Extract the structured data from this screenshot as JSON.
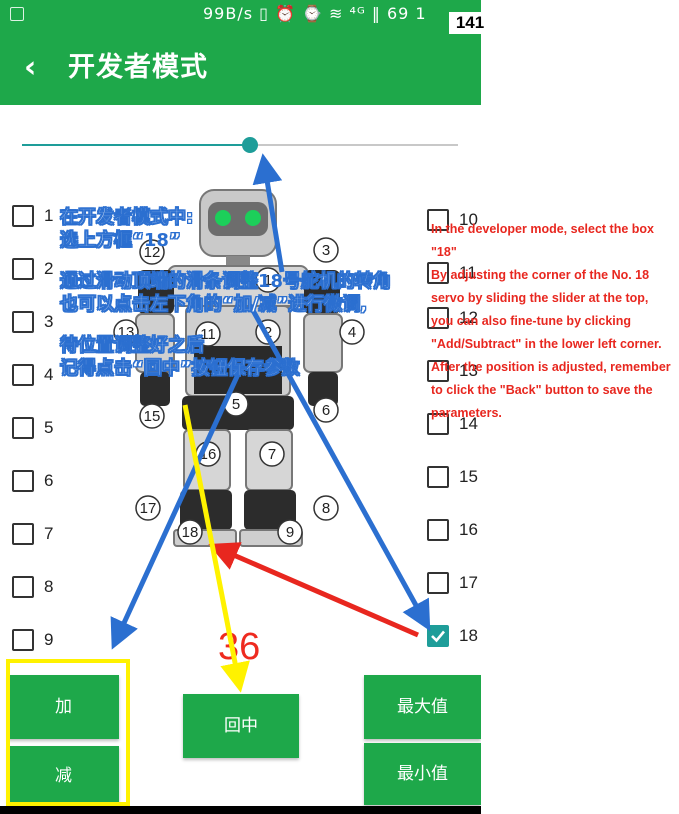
{
  "status_bar": {
    "text": "99B/s ▯ ⏰ ⌚ ≋ ⁴ᴳ ‖ 69 1",
    "badge": "141"
  },
  "app_bar": {
    "back_icon": "chevron-left-icon",
    "title": "开发者模式"
  },
  "slider": {
    "value_fraction": 0.52
  },
  "checkboxes_left": [
    {
      "label": "1",
      "checked": false
    },
    {
      "label": "2",
      "checked": false
    },
    {
      "label": "3",
      "checked": false
    },
    {
      "label": "4",
      "checked": false
    },
    {
      "label": "5",
      "checked": false
    },
    {
      "label": "6",
      "checked": false
    },
    {
      "label": "7",
      "checked": false
    },
    {
      "label": "8",
      "checked": false
    },
    {
      "label": "9",
      "checked": false
    }
  ],
  "checkboxes_right": [
    {
      "label": "10",
      "checked": false
    },
    {
      "label": "11",
      "checked": false
    },
    {
      "label": "12",
      "checked": false
    },
    {
      "label": "13",
      "checked": false
    },
    {
      "label": "14",
      "checked": false
    },
    {
      "label": "15",
      "checked": false
    },
    {
      "label": "16",
      "checked": false
    },
    {
      "label": "17",
      "checked": false
    },
    {
      "label": "18",
      "checked": true
    }
  ],
  "robot_labels": [
    "3",
    "12",
    "11",
    "13",
    "1",
    "2",
    "4",
    "15",
    "5",
    "6",
    "16",
    "7",
    "17",
    "8",
    "18",
    "9"
  ],
  "buttons": {
    "add": "加",
    "subtract": "减",
    "center": "回中",
    "max": "最大值",
    "min": "最小值"
  },
  "servo_value": "36",
  "annotation_cn": {
    "line1": "在开发者模式中:",
    "line2_a": "选上方框“",
    "line2_b": "18",
    "line2_c": "”",
    "line3_a": "通过滑动顶端的滑条调整",
    "line3_b": "18",
    "line3_c": "号舵机的转角",
    "line4": "也可以点击左下角的“加/减”进行微调,",
    "line5": "待位置调整好之后",
    "line6": "记得点击“回中”按钮保存参数"
  },
  "annotation_en": [
    "In the developer mode, select the box \"18\"",
    "By adjusting the corner of the No. 18 servo by sliding the slider at the top, you can also fine-tune by clicking \"Add/Subtract\" in the lower left corner.",
    "After the position is adjusted, remember to click the \"Back\" button to save the parameters."
  ],
  "colors": {
    "primary_green": "#1ea84a",
    "teal_accent": "#1e9d99",
    "annotation_blue": "#2b6fd0",
    "annotation_red": "#e8271f",
    "annotation_yellow": "#fff200"
  }
}
